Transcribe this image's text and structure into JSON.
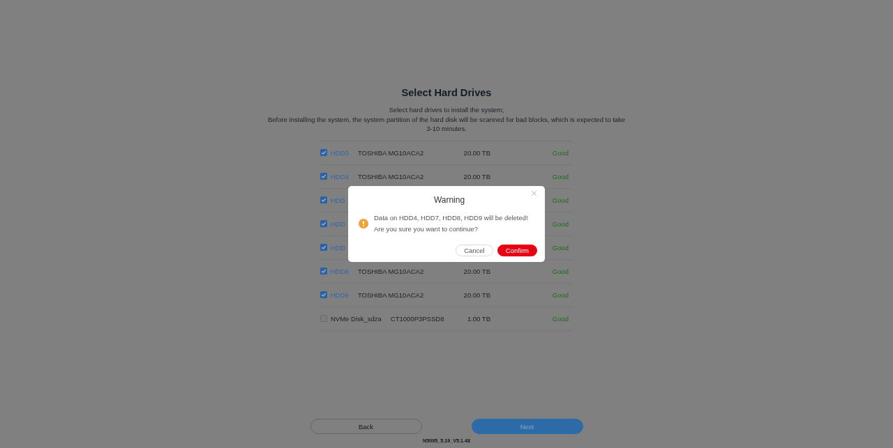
{
  "page": {
    "title": "Select Hard Drives",
    "description": [
      "Select hard drives to install the system;",
      "Before installing the system, the system partition of the hard disk will be scanned for bad blocks, which is expected to take 3-10 minutes."
    ]
  },
  "drives": [
    {
      "name": "HDD3",
      "model": "TOSHIBA MG10ACA2",
      "size": "20.00 TB",
      "status": "Good",
      "checked": true
    },
    {
      "name": "HDD4",
      "model": "TOSHIBA MG10ACA2",
      "size": "20.00 TB",
      "status": "Good",
      "checked": true
    },
    {
      "name": "HDD",
      "status": "Good",
      "checked": true
    },
    {
      "name": "HDD",
      "status": "Good",
      "checked": true
    },
    {
      "name": "HDD",
      "status": "Good",
      "checked": true
    },
    {
      "name": "HDD8",
      "model": "TOSHIBA MG10ACA2",
      "size": "20.00 TB",
      "status": "Good",
      "checked": true
    },
    {
      "name": "HDD9",
      "model": "TOSHIBA MG10ACA2",
      "size": "20.00 TB",
      "status": "Good",
      "checked": true
    },
    {
      "name": "NVMe Disk_sdza",
      "model": "CT1000P3PSSD8",
      "size": "1.00 TB",
      "status": "Good",
      "checked": false
    }
  ],
  "buttons": [
    {
      "label": "Back",
      "kind": "secondary",
      "disabled": false
    },
    {
      "label": "Next",
      "kind": "primary",
      "disabled": true
    }
  ],
  "version": "N5095_5.19_V5.1.48",
  "dialog": {
    "title": "Warning",
    "message": [
      "Data on HDD4, HDD7, HDD8, HDD9 will be deleted!",
      "Are you sure you want to continue?"
    ],
    "buttons": [
      {
        "label": "Cancel",
        "kind": "secondary"
      },
      {
        "label": "Confirm",
        "kind": "danger"
      }
    ]
  }
}
